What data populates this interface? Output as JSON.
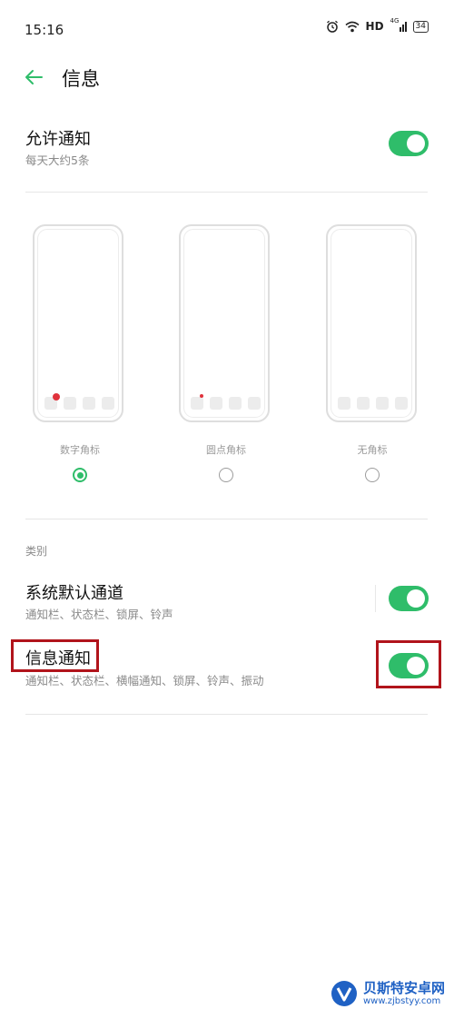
{
  "status_bar": {
    "time": "15:16",
    "hd": "HD",
    "network": "4G",
    "battery": "34"
  },
  "header": {
    "title": "信息"
  },
  "allow": {
    "title": "允许通知",
    "subtitle": "每天大约5条",
    "enabled": true
  },
  "badge_styles": [
    {
      "label": "数字角标",
      "selected": true
    },
    {
      "label": "圆点角标",
      "selected": false
    },
    {
      "label": "无角标",
      "selected": false
    }
  ],
  "category": {
    "label": "类别",
    "items": [
      {
        "title": "系统默认通道",
        "subtitle": "通知栏、状态栏、锁屏、铃声",
        "enabled": true
      },
      {
        "title": "信息通知",
        "subtitle": "通知栏、状态栏、横幅通知、锁屏、铃声、振动",
        "enabled": true
      }
    ]
  },
  "watermark": {
    "name": "贝斯特安卓网",
    "url": "www.zjbstyy.com"
  },
  "colors": {
    "accent": "#2fbd6a",
    "highlight": "#b1141b",
    "badge": "#e0323c"
  },
  "icons": [
    "alarm-icon",
    "wifi-icon",
    "signal-icon",
    "battery-icon",
    "back-arrow-icon"
  ]
}
